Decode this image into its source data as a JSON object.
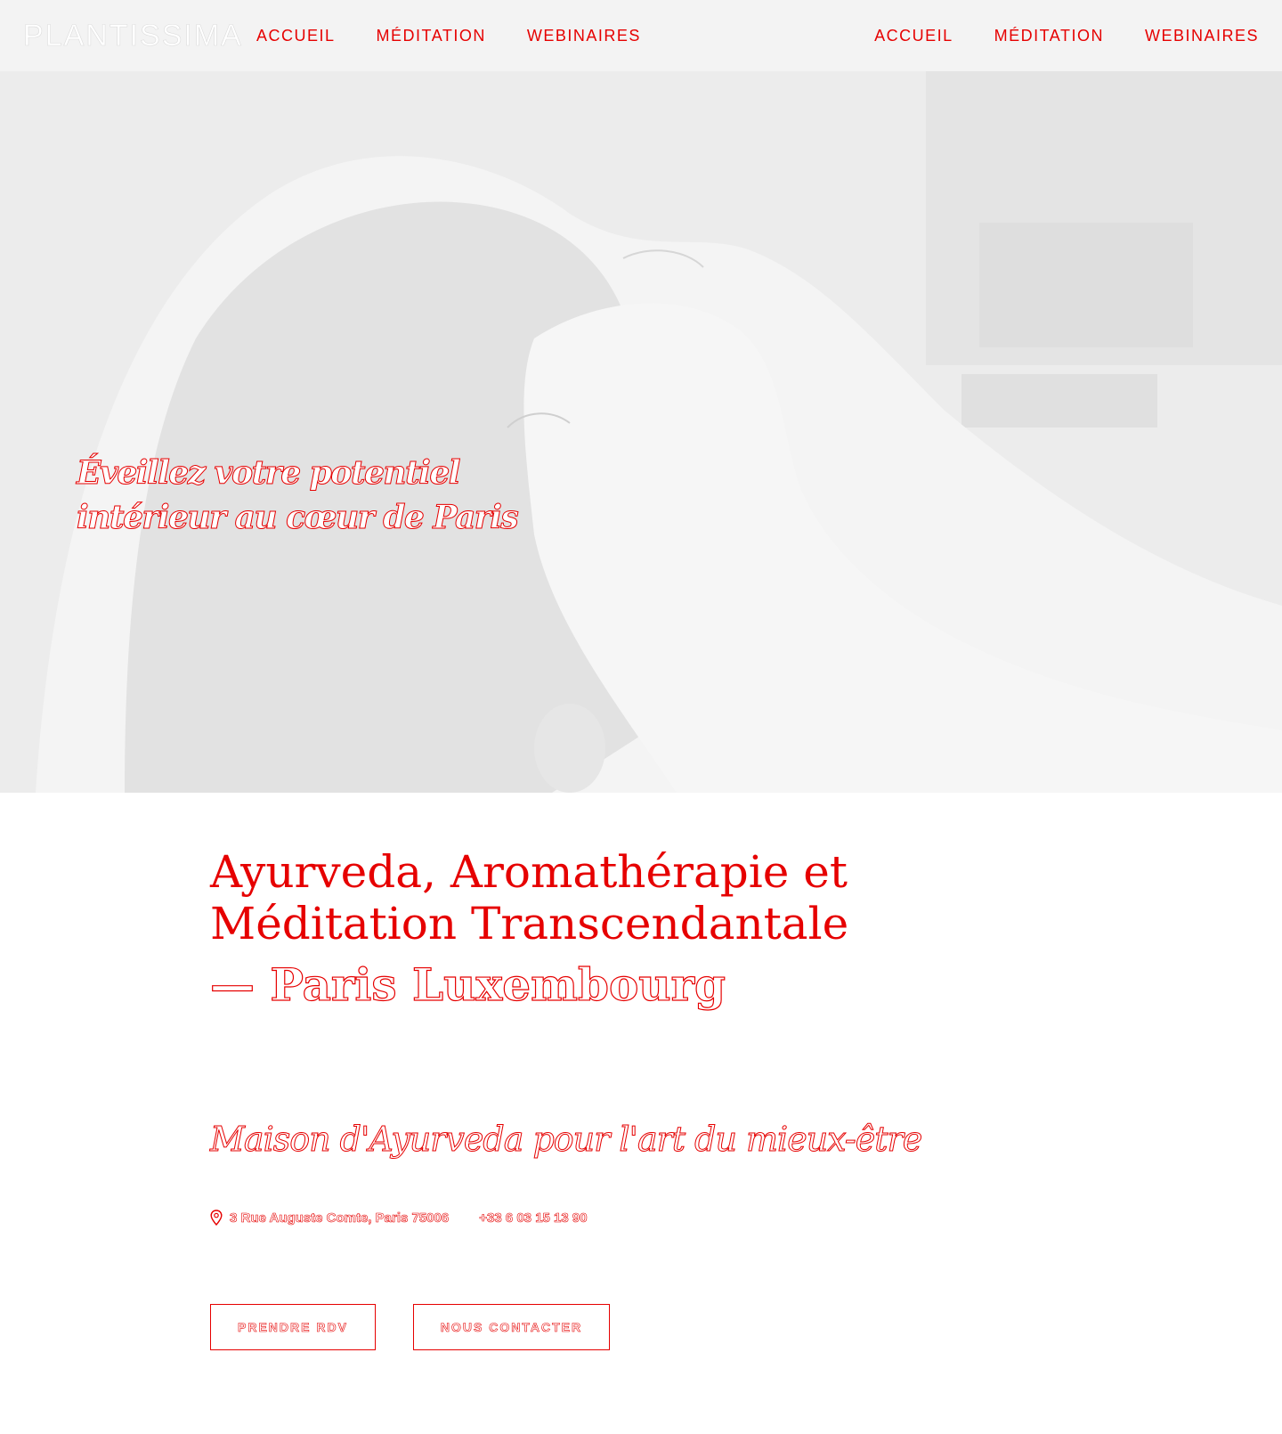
{
  "brand": {
    "logo_text": "PLANTISSIMA"
  },
  "nav_left": [
    {
      "label": "ACCUEIL"
    },
    {
      "label": "MÉDITATION"
    },
    {
      "label": "WEBINAIRES"
    }
  ],
  "nav_right": [
    {
      "label": "ACCUEIL"
    },
    {
      "label": "MÉDITATION"
    },
    {
      "label": "WEBINAIRES"
    }
  ],
  "hero": {
    "title_line1": "Éveillez votre potentiel",
    "title_line2": "intérieur au cœur de Paris"
  },
  "intro": {
    "heading": "Ayurveda, Aromathérapie et Méditation Transcendantale",
    "subheading": "— Paris Luxembourg",
    "tagline": "Maison d'Ayurveda pour l'art du mieux-être"
  },
  "contact": {
    "address": "3 Rue Auguste Comte, Paris 75006",
    "phone": "+33 6 03 15 13 90"
  },
  "buttons": {
    "book": "PRENDRE RDV",
    "contact": "NOUS CONTACTER"
  },
  "colors": {
    "accent": "#e60000",
    "header_bg": "#f3f3f3"
  },
  "icons": {
    "address": "map-pin-icon"
  }
}
